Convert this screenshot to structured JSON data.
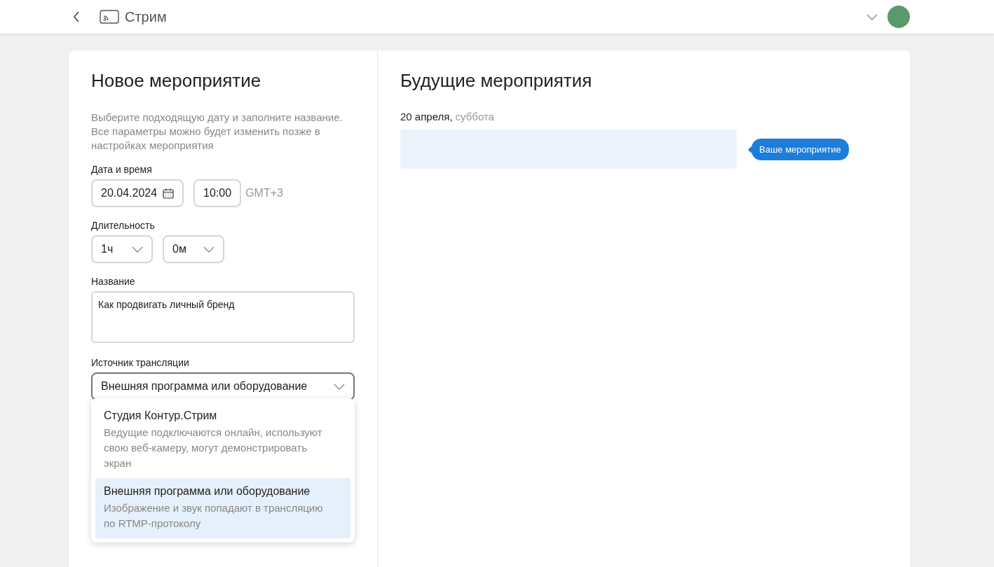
{
  "header": {
    "title": "Стрим"
  },
  "new_event": {
    "title": "Новое мероприятие",
    "description": "Выберите подходящую дату и заполните название. Все параметры можно будет изменить позже в настройках мероприятия",
    "datetime": {
      "label": "Дата и время",
      "date": "20.04.2024",
      "time": "10:00",
      "timezone": "GMT+3"
    },
    "duration": {
      "label": "Длительность",
      "hours": "1ч",
      "minutes": "0м"
    },
    "name": {
      "label": "Название",
      "value": "Как продвигать личный бренд"
    },
    "source": {
      "label": "Источник трансляции",
      "value": "Внешняя программа или оборудование",
      "expanded": true,
      "options": [
        {
          "title": "Студия Контур.Стрим",
          "description": "Ведущие подключаются онлайн, используют свою веб-камеру, могут демонстрировать экран",
          "selected": false
        },
        {
          "title": "Внешняя программа или оборудование",
          "description": "Изображение и звук попадают в трансляцию по RTMP-протоколу",
          "selected": true
        }
      ]
    }
  },
  "upcoming": {
    "title": "Будущие мероприятия",
    "date": "20 апреля,",
    "weekday": "суббота",
    "tooltip": "Ваше мероприятие"
  }
}
